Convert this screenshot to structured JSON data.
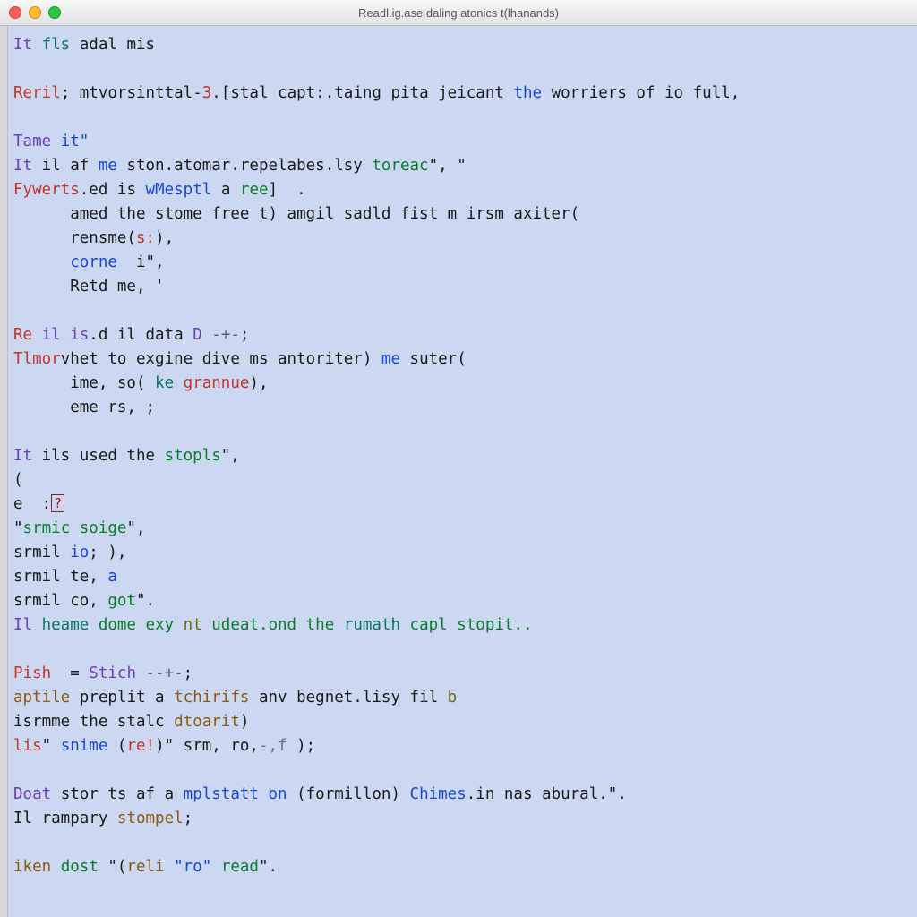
{
  "window": {
    "title": "Readl.ig.ase daling atonics t(lhanands)"
  },
  "code": {
    "l01a": "It ",
    "l01b": "fls ",
    "l01c": "adal mis",
    "l02_empty": "",
    "l03a": "Reril",
    "l03b": "; mtvorsinttal-",
    "l03c": "3",
    "l03d": ".[stal capt:.taing pita jeicant ",
    "l03e": "the ",
    "l03f": "worriers of io full,",
    "l04_empty": "",
    "l05a": "Tame ",
    "l05b": "it\"",
    "l06a": "It ",
    "l06b": "il af ",
    "l06c": "me ",
    "l06d": "ston.atomar.repelabes.lsy ",
    "l06e": "toreac",
    "l06f": "\", \"",
    "l07a": "Fywerts",
    "l07b": ".ed is ",
    "l07c": "wMesptl ",
    "l07d": "a ",
    "l07e": "ree",
    "l07f": "]  .",
    "l08": "      amed the stome free t) amgil sadld fist m irsm axiter(",
    "l09a": "      rensme(",
    "l09b": "s:",
    "l09c": "),",
    "l10a": "      ",
    "l10b": "corne  ",
    "l10c": "i\",",
    "l11": "      Retd me, '",
    "l12_empty": "",
    "l13a": "Re ",
    "l13b": "il is",
    "l13c": ".d il data ",
    "l13d": "D ",
    "l13e": "-+-",
    "l13f": ";",
    "l14a": "Tlmor",
    "l14b": "vhet to exgine dive ms antoriter) ",
    "l14c": "me ",
    "l14d": "suter(",
    "l15a": "      ime, so( ",
    "l15b": "ke ",
    "l15c": "grannue",
    "l15d": "),",
    "l16": "      eme rs, ;",
    "l17_empty": "",
    "l18a": "It ",
    "l18b": "ils used the ",
    "l18c": "stopls",
    "l18d": "\",",
    "l19": "(",
    "l20a": "e  :",
    "l20b": "?",
    "l21a": "\"",
    "l21b": "srmic soige",
    "l21c": "\",",
    "l22a": "srmil ",
    "l22b": "io",
    "l22c": "; ),",
    "l23a": "srmil te, ",
    "l23b": "a",
    "l24a": "srmil co, ",
    "l24b": "got",
    "l24c": "\".",
    "l25a": "Il ",
    "l25b": "heame ",
    "l25c": "dome exy ",
    "l25d": "nt ",
    "l25e": "udeat.ond the ",
    "l25f": "rumath ",
    "l25g": "capl stopit..",
    "l26_empty": "",
    "l27a": "Pish  ",
    "l27b": "= ",
    "l27c": "Stich ",
    "l27d": "--+-",
    "l27e": ";",
    "l28a": "aptile ",
    "l28b": "preplit a ",
    "l28c": "tchirifs ",
    "l28d": "anv begnet.lisy fil ",
    "l28e": "b",
    "l29a": "isrmme the stalc ",
    "l29b": "dtoarit",
    "l29c": ")",
    "l30a": "lis",
    "l30b": "\" ",
    "l30c": "snime ",
    "l30d": "(",
    "l30e": "re!",
    "l30f": ")\" srm, ro,",
    "l30g": "-,f ",
    "l30h": ");",
    "l31_empty": "",
    "l32a": "Doat ",
    "l32b": "stor ts af a ",
    "l32c": "mplstatt on ",
    "l32d": "(formillon) ",
    "l32e": "Chimes",
    "l32f": ".in nas abural.\".",
    "l33a": "Il rampary ",
    "l33b": "stompel",
    "l33c": ";",
    "l34_empty": "",
    "l35a": "iken ",
    "l35b": "dost ",
    "l35c": "\"(",
    "l35d": "reli ",
    "l35e": "\"ro\" ",
    "l35f": "read",
    "l35g": "\"."
  }
}
